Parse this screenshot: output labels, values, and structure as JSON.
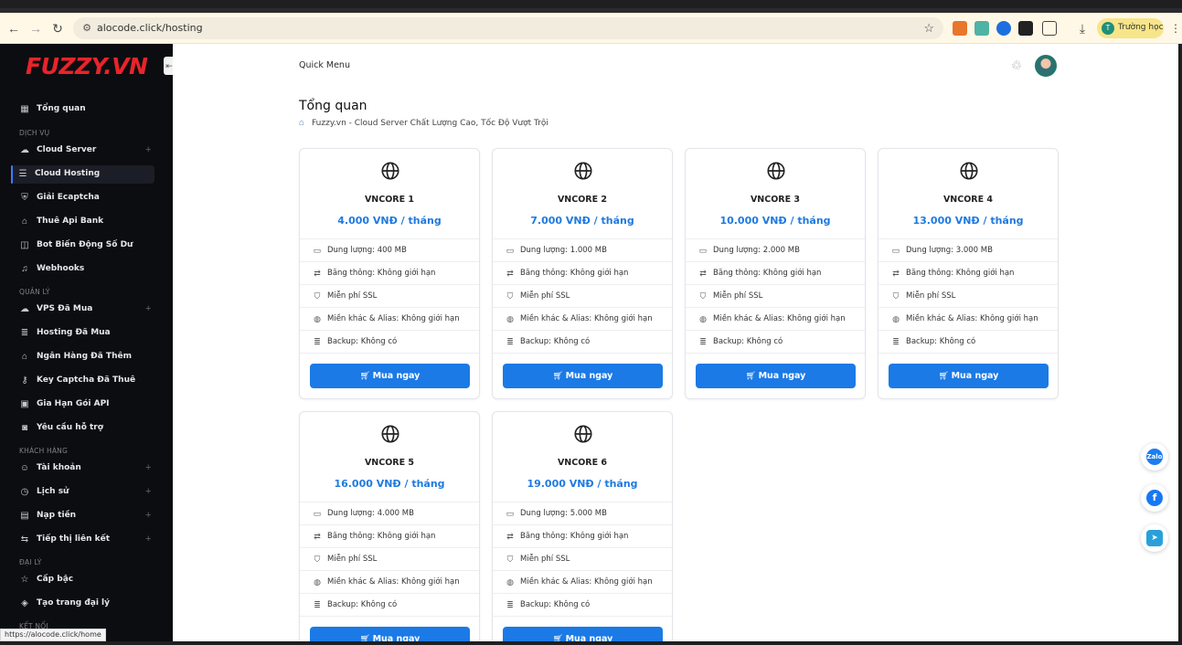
{
  "browser": {
    "url": "alocode.click/hosting",
    "profile_label": "Trường học",
    "profile_initial": "T",
    "status_url": "https://alocode.click/home"
  },
  "sidebar": {
    "logo": "FUZZY.VN",
    "sections": {
      "services": "DỊCH VỤ",
      "manage": "QUẢN LÝ",
      "customer": "KHÁCH HÀNG",
      "agency": "ĐẠI LÝ",
      "connect": "KẾT NỐI"
    },
    "items": [
      {
        "label": "Tổng quan"
      },
      {
        "label": "Cloud Server"
      },
      {
        "label": "Cloud Hosting"
      },
      {
        "label": "Giải Ecaptcha"
      },
      {
        "label": "Thuê Api Bank"
      },
      {
        "label": "Bot Biến Động Số Dư"
      },
      {
        "label": "Webhooks"
      },
      {
        "label": "VPS Đã Mua"
      },
      {
        "label": "Hosting Đã Mua"
      },
      {
        "label": "Ngân Hàng Đã Thêm"
      },
      {
        "label": "Key Captcha Đã Thuê"
      },
      {
        "label": "Gia Hạn Gói API"
      },
      {
        "label": "Yêu cầu hỗ trợ"
      },
      {
        "label": "Tài khoản"
      },
      {
        "label": "Lịch sử"
      },
      {
        "label": "Nạp tiền"
      },
      {
        "label": "Tiếp thị liên kết"
      },
      {
        "label": "Cấp bậc"
      },
      {
        "label": "Tạo trang đại lý"
      }
    ]
  },
  "header": {
    "quick_menu": "Quick Menu"
  },
  "page": {
    "title": "Tổng quan",
    "breadcrumb": "Fuzzy.vn - Cloud Server Chất Lượng Cao, Tốc Độ Vượt Trội"
  },
  "buy_label": "Mua ngay",
  "plans": [
    {
      "name": "VNCORE 1",
      "price": "4.000 VNĐ / tháng",
      "features": [
        "Dung lượng: 400 MB",
        "Băng thông: Không giới hạn",
        "Miễn phí SSL",
        "Miền khác & Alias: Không giới hạn",
        "Backup: Không có"
      ]
    },
    {
      "name": "VNCORE 2",
      "price": "7.000 VNĐ / tháng",
      "features": [
        "Dung lượng: 1.000 MB",
        "Băng thông: Không giới hạn",
        "Miễn phí SSL",
        "Miền khác & Alias: Không giới hạn",
        "Backup: Không có"
      ]
    },
    {
      "name": "VNCORE 3",
      "price": "10.000 VNĐ / tháng",
      "features": [
        "Dung lượng: 2.000 MB",
        "Băng thông: Không giới hạn",
        "Miễn phí SSL",
        "Miền khác & Alias: Không giới hạn",
        "Backup: Không có"
      ]
    },
    {
      "name": "VNCORE 4",
      "price": "13.000 VNĐ / tháng",
      "features": [
        "Dung lượng: 3.000 MB",
        "Băng thông: Không giới hạn",
        "Miễn phí SSL",
        "Miền khác & Alias: Không giới hạn",
        "Backup: Không có"
      ]
    },
    {
      "name": "VNCORE 5",
      "price": "16.000 VNĐ / tháng",
      "features": [
        "Dung lượng: 4.000 MB",
        "Băng thông: Không giới hạn",
        "Miễn phí SSL",
        "Miền khác & Alias: Không giới hạn",
        "Backup: Không có"
      ]
    },
    {
      "name": "VNCORE 6",
      "price": "19.000 VNĐ / tháng",
      "features": [
        "Dung lượng: 5.000 MB",
        "Băng thông: Không giới hạn",
        "Miễn phí SSL",
        "Miền khác & Alias: Không giới hạn",
        "Backup: Không có"
      ]
    }
  ],
  "floating": {
    "zalo": "Zalo",
    "facebook": "f",
    "telegram": "➤"
  },
  "colors": {
    "accent": "#1b7ae6",
    "price": "#1f7ae0",
    "sidebar_bg": "#0c0d10",
    "logo": "#e8242b"
  }
}
